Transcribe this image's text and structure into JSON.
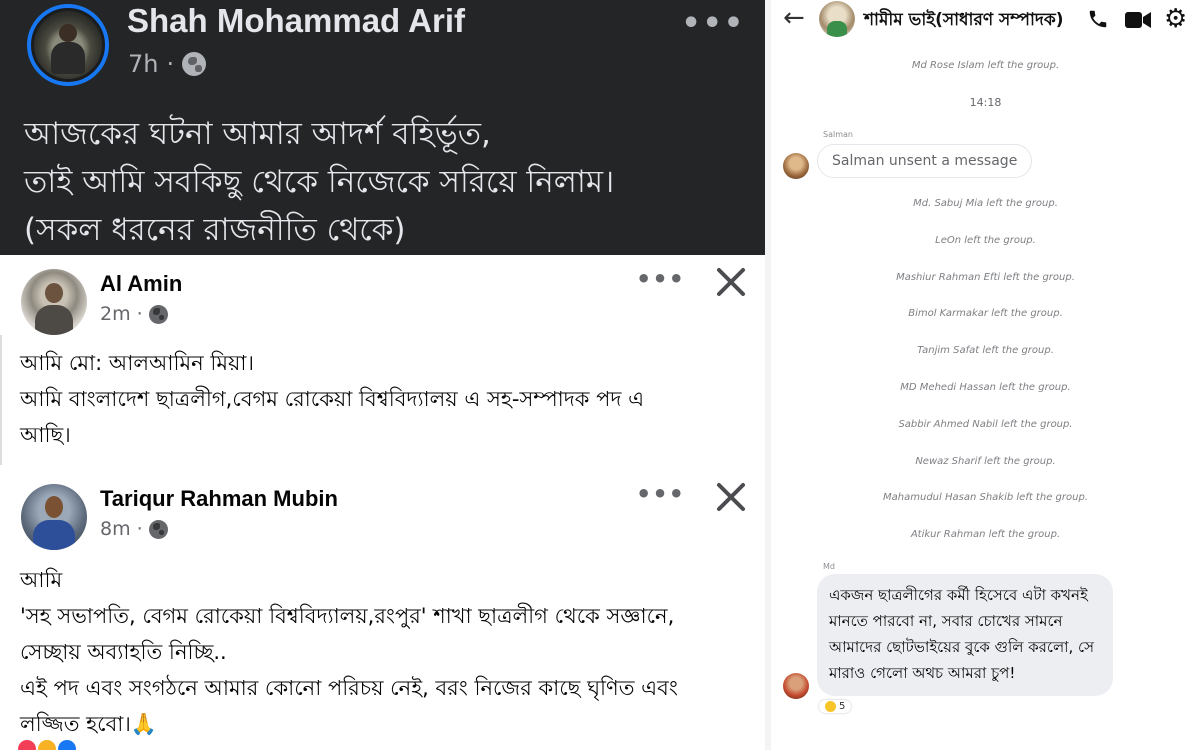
{
  "dark_post": {
    "author": "Shah Mohammad Arif",
    "time": "7h",
    "privacy_separator": "·",
    "menu": "•••",
    "lines": [
      "আজকের ঘটনা আমার আদর্শ বহির্ভূত,",
      "তাই আমি সবকিছু থেকে নিজেকে সরিয়ে নিলাম।",
      "(সকল ধরনের রাজনীতি থেকে)"
    ]
  },
  "post_al_amin": {
    "author": "Al Amin",
    "time": "2m",
    "privacy_separator": "·",
    "menu": "•••",
    "lines": [
      "আমি মো: আলআমিন মিয়া।",
      "আমি বাংলাদেশ ছাত্রলীগ,বেগম রোকেয়া বিশ্ববিদ্যালয় এ সহ-সম্পাদক পদ এ",
      "আছি।"
    ]
  },
  "post_tariqur": {
    "author": "Tariqur Rahman Mubin",
    "time": "8m",
    "privacy_separator": "·",
    "menu": "•••",
    "lines": [
      "আমি",
      "'সহ সভাপতি, বেগম রোকেয়া বিশ্ববিদ্যালয়,রংপুর' শাখা ছাত্রলীগ থেকে সজ্ঞানে,",
      "সেচ্ছায় অব্যাহতি নিচ্ছি..",
      "এই পদ এবং সংগঠনে আমার কোনো পরিচয় নেই, বরং নিজের কাছে ঘৃণিত এবং",
      "লজ্জিত হবো।🙏"
    ]
  },
  "chat": {
    "back": "←",
    "title": "শামীম ভাই(সাধারণ সম্পাদক)",
    "gear": "⚙",
    "system_top": "Md Rose Islam left the group.",
    "timestamp": "14:18",
    "salman_sender": "Salman",
    "salman_unsent": "Salman unsent a message",
    "system_messages": [
      "Md. Sabuj Mia left the group.",
      "LeOn left the group.",
      "Mashiur Rahman Efti left the group.",
      "Bimol Karmakar left the group.",
      "Tanjim Safat left the group.",
      "MD Mehedi Hassan left the group.",
      "Sabbir Ahmed Nabil left the group.",
      "Newaz Sharif left the group.",
      "Mahamudul Hasan Shakib left the group.",
      "Atikur Rahman left the group."
    ],
    "md_sender": "Md",
    "md_message": "একজন ছাত্রলীগের কর্মী হিসেবে এটা কখনই মানতে পারবো না, সবার চোখের সামনে আমাদের ছোটভাইয়ের বুকে গুলি করলো, সে মারাও গেলো অথচ আমরা চুপ!",
    "reaction_count": "5"
  },
  "colors": {
    "dark_bg": "#242526",
    "accent_blue": "#1877f2",
    "bubble_gray": "#eceef1"
  },
  "icons": [
    "globe-icon",
    "close-icon",
    "back-arrow-icon",
    "phone-icon",
    "video-icon",
    "gear-icon",
    "more-options-icon"
  ]
}
